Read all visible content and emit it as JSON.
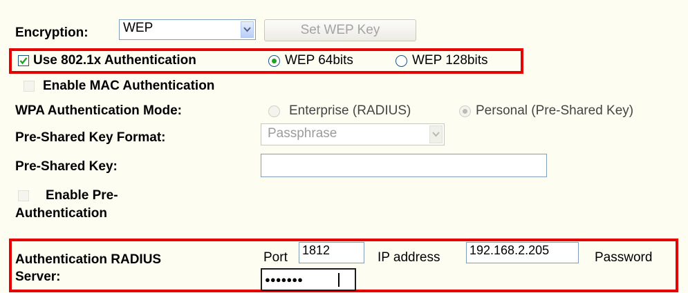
{
  "encryption": {
    "label": "Encryption:",
    "selected": "WEP",
    "set_key_button": "Set WEP Key"
  },
  "use_8021x": {
    "label": "Use 802.1x Authentication",
    "checked": true,
    "wep64_label": "WEP 64bits",
    "wep128_label": "WEP 128bits",
    "selected": "WEP 64bits"
  },
  "mac_auth": {
    "label": "Enable MAC Authentication",
    "checked": false
  },
  "wpa_mode": {
    "label": "WPA Authentication Mode:",
    "enterprise_label": "Enterprise (RADIUS)",
    "personal_label": "Personal (Pre-Shared Key)",
    "selected": "Personal (Pre-Shared Key)"
  },
  "psk_format": {
    "label": "Pre-Shared Key Format:",
    "selected": "Passphrase"
  },
  "psk": {
    "label": "Pre-Shared Key:",
    "value": ""
  },
  "pre_auth": {
    "label_line1": "Enable Pre-",
    "label_line2": "Authentication",
    "checked": false
  },
  "radius": {
    "label_line1": "Authentication RADIUS",
    "label_line2": "Server:",
    "port_label": "Port",
    "port_value": "1812",
    "ip_label": "IP address",
    "ip_value": "192.168.2.205",
    "password_label": "Password",
    "password_mask": "●●●●●●●"
  },
  "colors": {
    "background": "#fdfdf1",
    "highlight": "#e60000",
    "check_green": "#21a121"
  }
}
